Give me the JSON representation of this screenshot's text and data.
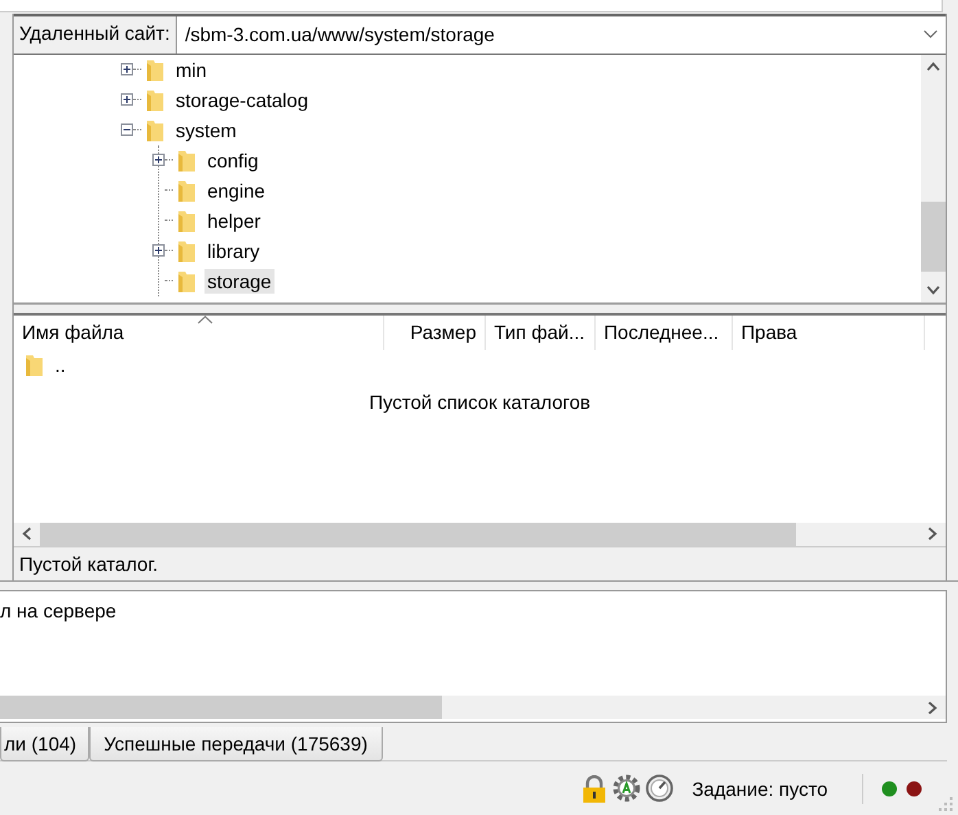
{
  "remote_site": {
    "label": "Удаленный сайт:",
    "path": "/sbm-3.com.ua/www/system/storage"
  },
  "tree": [
    {
      "name": "min",
      "kind": "collapsed",
      "selected": false
    },
    {
      "name": "storage-catalog",
      "kind": "collapsed",
      "selected": false
    },
    {
      "name": "system",
      "kind": "expanded",
      "selected": false,
      "children": [
        {
          "name": "config",
          "kind": "collapsed",
          "selected": false
        },
        {
          "name": "engine",
          "kind": "leaf",
          "selected": false
        },
        {
          "name": "helper",
          "kind": "leaf",
          "selected": false
        },
        {
          "name": "library",
          "kind": "collapsed",
          "selected": false
        },
        {
          "name": "storage",
          "kind": "leaf",
          "selected": true
        }
      ]
    }
  ],
  "file_list": {
    "columns": [
      "Имя файла",
      "Размер",
      "Тип фай...",
      "Последнее...",
      "Права"
    ],
    "rows": [
      {
        "name": ".."
      }
    ],
    "empty_message": "Пустой список каталогов"
  },
  "remote_status": "Пустой каталог.",
  "log": {
    "text": "л на сервере"
  },
  "queue_tabs": [
    {
      "label": "ли (104)",
      "selected": false
    },
    {
      "label": "Успешные передачи (175639)",
      "selected": false
    }
  ],
  "status_bar": {
    "queue": "Задание: пусто",
    "lights": [
      {
        "color": "#1f8f1f"
      },
      {
        "color": "#8b1414"
      }
    ]
  }
}
